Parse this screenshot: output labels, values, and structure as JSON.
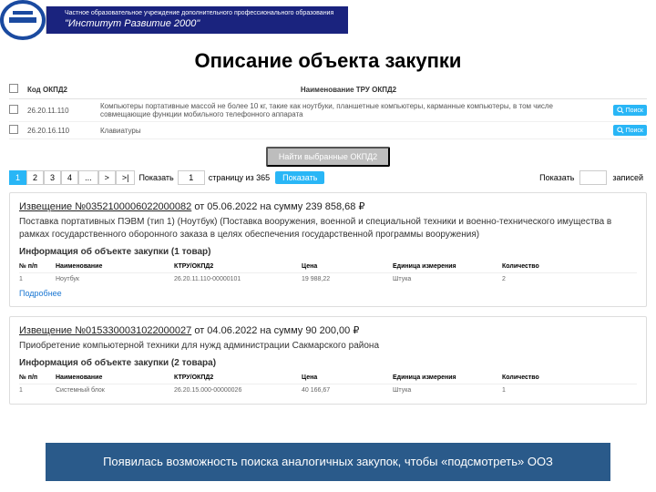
{
  "header": {
    "line1": "Частное образовательное учреждение дополнительного профессионального образования",
    "line2": "\"Институт Развитие 2000\""
  },
  "title": "Описание объекта закупки",
  "table": {
    "head": {
      "code": "Код ОКПД2",
      "name": "Наименование ТРУ ОКПД2"
    },
    "rows": [
      {
        "code": "26.20.11.110",
        "name": "Компьютеры портативные массой не более 10 кг, такие как ноутбуки, планшетные компьютеры, карманные компьютеры, в том числе совмещающие функции мобильного телефонного аппарата"
      },
      {
        "code": "26.20.16.110",
        "name": "Клавиатуры"
      }
    ],
    "search_label": "Поиск"
  },
  "find_label": "Найти выбранные ОКПД2",
  "pager": {
    "pages": [
      "1",
      "2",
      "3",
      "4",
      "...",
      ">",
      ">|"
    ],
    "show_label": "Показать",
    "page_input": "1",
    "page_of": "страницу из 365",
    "show_btn": "Показать",
    "records_label": "записей",
    "records_input": ""
  },
  "cards": [
    {
      "nz": "Извещение №0352100006022000082",
      "meta": " от 05.06.2022 на сумму 239 858,68 ₽",
      "desc": "Поставка портативных ПЭВМ (тип 1) (Ноутбук) (Поставка вооружения, военной и специальной техники и военно-технического имущества в рамках государственного оборонного заказа в целях обеспечения государственной программы вооружения)",
      "info": "Информация об объекте закупки (1 товар)",
      "itemsHead": [
        "№ п/п",
        "Наименование",
        "КТРУ/ОКПД2",
        "Цена",
        "Единица измерения",
        "Количество"
      ],
      "items": [
        [
          "1",
          "Ноутбук",
          "26.20.11.110-00000101",
          "19 988,22",
          "Штука",
          "2"
        ]
      ],
      "more": "Подробнее"
    },
    {
      "nz": "Извещение №0153300031022000027",
      "meta": " от 04.06.2022 на сумму 90 200,00 ₽",
      "desc": "Приобретение компьютерной техники для нужд администрации Сакмарского района",
      "info": "Информация об объекте закупки (2 товара)",
      "itemsHead": [
        "№ п/п",
        "Наименование",
        "КТРУ/ОКПД2",
        "Цена",
        "Единица измерения",
        "Количество"
      ],
      "items": [
        [
          "1",
          "Системный блок",
          "26.20.15.000-00000026",
          "40 166,67",
          "Штука",
          "1"
        ]
      ]
    }
  ],
  "footer": "Появилась возможность поиска аналогичных закупок, чтобы «подсмотреть» ООЗ"
}
